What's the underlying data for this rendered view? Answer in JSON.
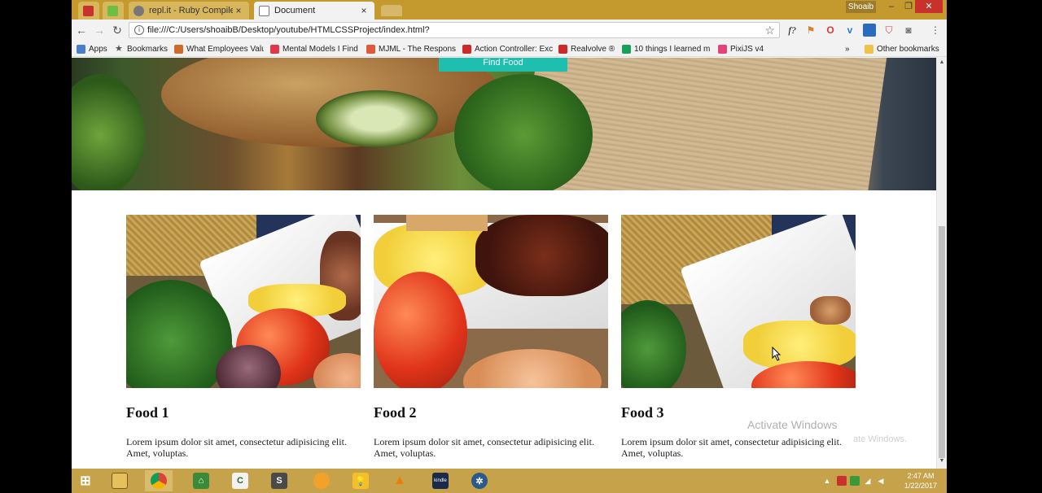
{
  "browser": {
    "tabs": [
      {
        "title": "",
        "icon": "red-feather-icon"
      },
      {
        "title": "",
        "icon": "upwork-u-icon"
      },
      {
        "title": "repl.it - Ruby Compiler",
        "icon": "replit-icon"
      },
      {
        "title": "Document",
        "icon": "page-icon",
        "active": true
      }
    ],
    "profile_name": "Shoaib",
    "url": "file:///C:/Users/shoaibB/Desktop/youtube/HTMLCSSProject/index.html?",
    "bookmarks": [
      {
        "label": "Apps",
        "icon": "apps-grid-icon",
        "color": "#4a7ec9"
      },
      {
        "label": "Bookmarks",
        "icon": "star-icon",
        "color": "#555555"
      },
      {
        "label": "What Employees Valu",
        "icon": "site-icon",
        "color": "#d06a2a"
      },
      {
        "label": "Mental Models I Find",
        "icon": "pocket-icon",
        "color": "#e0384a"
      },
      {
        "label": "MJML - The Respons",
        "icon": "mjml-icon",
        "color": "#e05a3a"
      },
      {
        "label": "Action Controller: Exc",
        "icon": "rails-icon",
        "color": "#cc2a2a"
      },
      {
        "label": "Realvolve ®",
        "icon": "rails-icon",
        "color": "#cc2a2a"
      },
      {
        "label": "10 things I learned m",
        "icon": "medium-icon",
        "color": "#19a15a"
      },
      {
        "label": "PixiJS v4",
        "icon": "pixijs-icon",
        "color": "#e3427a"
      },
      {
        "label": "Other bookmarks",
        "icon": "folder-icon",
        "color": "#f1c24a"
      }
    ],
    "more_bookmarks": "»"
  },
  "page": {
    "hero_button": "Find Food",
    "cards": [
      {
        "title": "Food 1",
        "text": "Lorem ipsum dolor sit amet, consectetur adipisicing elit. Amet, voluptas."
      },
      {
        "title": "Food 2",
        "text": "Lorem ipsum dolor sit amet, consectetur adipisicing elit. Amet, voluptas."
      },
      {
        "title": "Food 3",
        "text": "Lorem ipsum dolor sit amet, consectetur adipisicing elit. Amet, voluptas."
      }
    ]
  },
  "watermark": {
    "line1": "Activate Windows",
    "line2": "ate Windows."
  },
  "taskbar": {
    "apps": [
      {
        "name": "windows-start-icon"
      },
      {
        "name": "file-explorer-icon"
      },
      {
        "name": "chrome-icon"
      },
      {
        "name": "camtasia-icon"
      },
      {
        "name": "camtasia-recorder-icon"
      },
      {
        "name": "sublime-text-icon"
      },
      {
        "name": "circle-app-icon"
      },
      {
        "name": "lightbulb-icon"
      },
      {
        "name": "vlc-icon"
      },
      {
        "name": "kindle-icon",
        "label": "kindle"
      },
      {
        "name": "settings-app-icon"
      }
    ],
    "time": "2:47 AM",
    "date": "1/22/2017"
  }
}
